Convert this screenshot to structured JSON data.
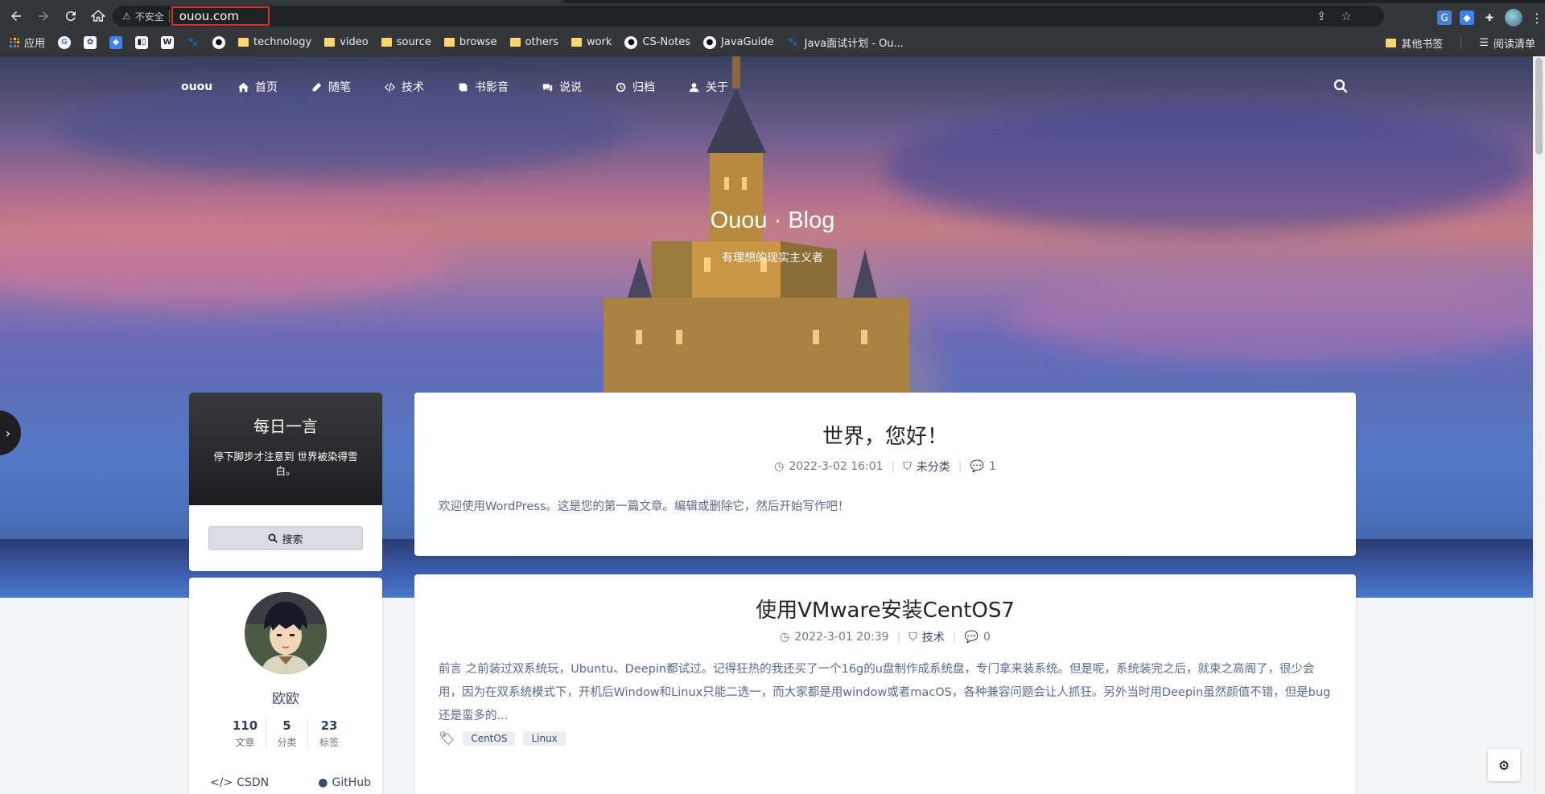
{
  "browser": {
    "security_label": "不安全",
    "url": "ouou.com"
  },
  "bookmarks": {
    "items": [
      {
        "label": "应用",
        "icon": "apps-grid-icon"
      },
      {
        "label": "",
        "icon": "google-icon"
      },
      {
        "label": "",
        "icon": "baidu-icon"
      },
      {
        "label": "",
        "icon": "blue-app-icon"
      },
      {
        "label": "",
        "icon": "trello-icon"
      },
      {
        "label": "",
        "icon": "wikipedia-icon"
      },
      {
        "label": "",
        "icon": "paw-icon"
      },
      {
        "label": "",
        "icon": "github-icon"
      },
      {
        "label": "technology",
        "icon": "folder-icon"
      },
      {
        "label": "video",
        "icon": "folder-icon"
      },
      {
        "label": "source",
        "icon": "folder-icon"
      },
      {
        "label": "browse",
        "icon": "folder-icon"
      },
      {
        "label": "others",
        "icon": "folder-icon"
      },
      {
        "label": "work",
        "icon": "folder-icon"
      },
      {
        "label": "CS-Notes",
        "icon": "github-icon"
      },
      {
        "label": "JavaGuide",
        "icon": "github-icon"
      },
      {
        "label": "Java面试计划 - Ou...",
        "icon": "paw-icon"
      }
    ],
    "other_bookmarks": "其他书签",
    "reading_list": "阅读清单"
  },
  "site": {
    "brand": "ouou",
    "nav": [
      {
        "label": "首页",
        "icon": "home-icon"
      },
      {
        "label": "随笔",
        "icon": "pencil-icon"
      },
      {
        "label": "技术",
        "icon": "code-icon"
      },
      {
        "label": "书影音",
        "icon": "book-icon"
      },
      {
        "label": "说说",
        "icon": "comments-icon"
      },
      {
        "label": "归档",
        "icon": "clock-icon"
      },
      {
        "label": "关于",
        "icon": "user-icon"
      }
    ],
    "hero_title": "Ouou · Blog",
    "hero_subtitle": "有理想的现实主义者"
  },
  "sidebar": {
    "quote_title": "每日一言",
    "quote_text": "停下脚步才注意到 世界被染得雪白。",
    "search_label": "搜索",
    "profile_name": "欧欧",
    "stats": [
      {
        "num": "110",
        "label": "文章"
      },
      {
        "num": "5",
        "label": "分类"
      },
      {
        "num": "23",
        "label": "标签"
      }
    ],
    "links": [
      {
        "label": "CSDN",
        "icon": "code-icon"
      },
      {
        "label": "GitHub",
        "icon": "github-icon"
      }
    ]
  },
  "posts": [
    {
      "title": "世界，您好！",
      "date": "2022-3-02 16:01",
      "category": "未分类",
      "comments": "1",
      "excerpt": "欢迎使用WordPress。这是您的第一篇文章。编辑或删除它，然后开始写作吧！"
    },
    {
      "title": "使用VMware安装CentOS7",
      "date": "2022-3-01 20:39",
      "category": "技术",
      "comments": "0",
      "excerpt": "前言 之前装过双系统玩，Ubuntu、Deepin都试过。记得狂热的我还买了一个16g的u盘制作成系统盘，专门拿来装系统。但是呢，系统装完之后，就束之高阁了，很少会用，因为在双系统模式下，开机后Window和Linux只能二选一，而大家都是用window或者macOS，各种兼容问题会让人抓狂。另外当时用Deepin虽然颜值不错，但是bug还是蛮多的...",
      "tags": [
        "CentOS",
        "Linux"
      ]
    }
  ]
}
